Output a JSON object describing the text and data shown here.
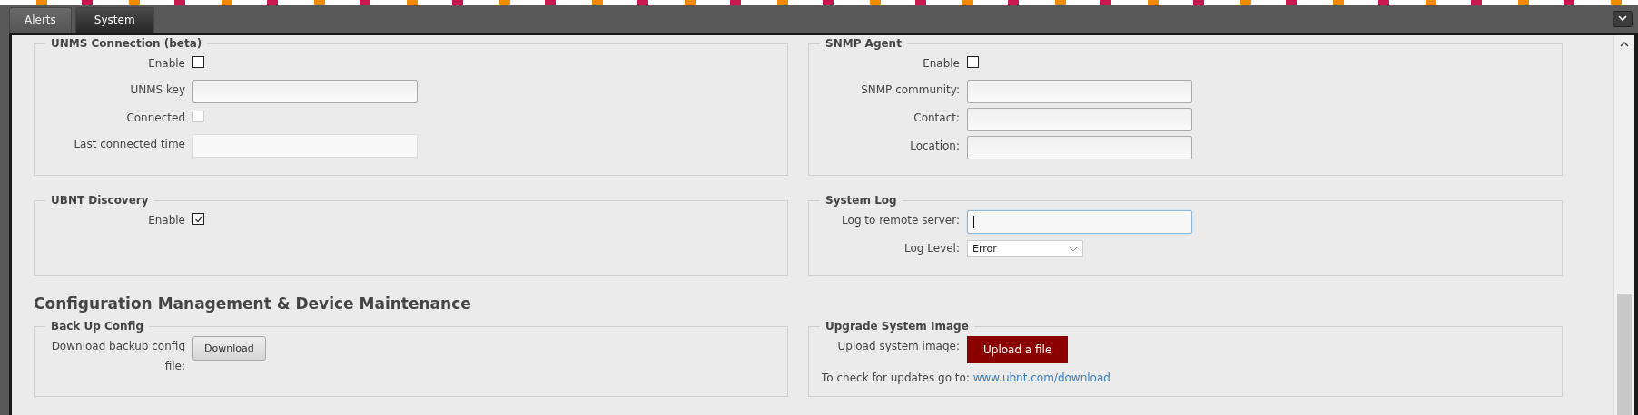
{
  "tabs": [
    {
      "label": "Alerts",
      "selected": false
    },
    {
      "label": "System",
      "selected": true
    }
  ],
  "sections": [
    {
      "kind": "pair",
      "panels": [
        {
          "legend": "UNMS Connection (beta)",
          "rows": [
            {
              "kind": "checkbox",
              "label": "Enable",
              "checked": false,
              "disabled": false
            },
            {
              "kind": "text",
              "label": "UNMS key",
              "disabled": false,
              "focused": false
            },
            {
              "kind": "checkbox",
              "label": "Connected",
              "checked": false,
              "disabled": true
            },
            {
              "kind": "text",
              "label": "Last connected time",
              "disabled": true,
              "focused": false
            }
          ]
        },
        {
          "legend": "SNMP Agent",
          "rows": [
            {
              "kind": "checkbox",
              "label": "Enable",
              "checked": false,
              "disabled": false
            },
            {
              "kind": "text",
              "label": "SNMP community:",
              "disabled": false,
              "focused": false
            },
            {
              "kind": "text",
              "label": "Contact:",
              "disabled": false,
              "focused": false
            },
            {
              "kind": "text",
              "label": "Location:",
              "disabled": false,
              "focused": false
            }
          ]
        }
      ]
    },
    {
      "kind": "pair",
      "panels": [
        {
          "legend": "UBNT Discovery",
          "rows": [
            {
              "kind": "checkbox",
              "label": "Enable",
              "checked": true,
              "disabled": false
            }
          ]
        },
        {
          "legend": "System Log",
          "rows": [
            {
              "kind": "text",
              "label": "Log to remote server:",
              "disabled": false,
              "focused": true
            },
            {
              "kind": "select",
              "label": "Log Level:",
              "value": "Error"
            }
          ]
        }
      ]
    },
    {
      "kind": "heading",
      "text": "Configuration Management & Device Maintenance"
    },
    {
      "kind": "pair",
      "panels": [
        {
          "legend": "Back Up Config",
          "rows": [
            {
              "kind": "button",
              "label": "Download backup config file:",
              "button": "Download"
            }
          ]
        },
        {
          "legend": "Upgrade System Image",
          "rows": [
            {
              "kind": "button",
              "label": "Upload system image:",
              "button": "Upload a file"
            },
            {
              "kind": "note",
              "text": "To check for updates go to: ",
              "link": "www.ubnt.com/download"
            }
          ]
        }
      ]
    }
  ]
}
